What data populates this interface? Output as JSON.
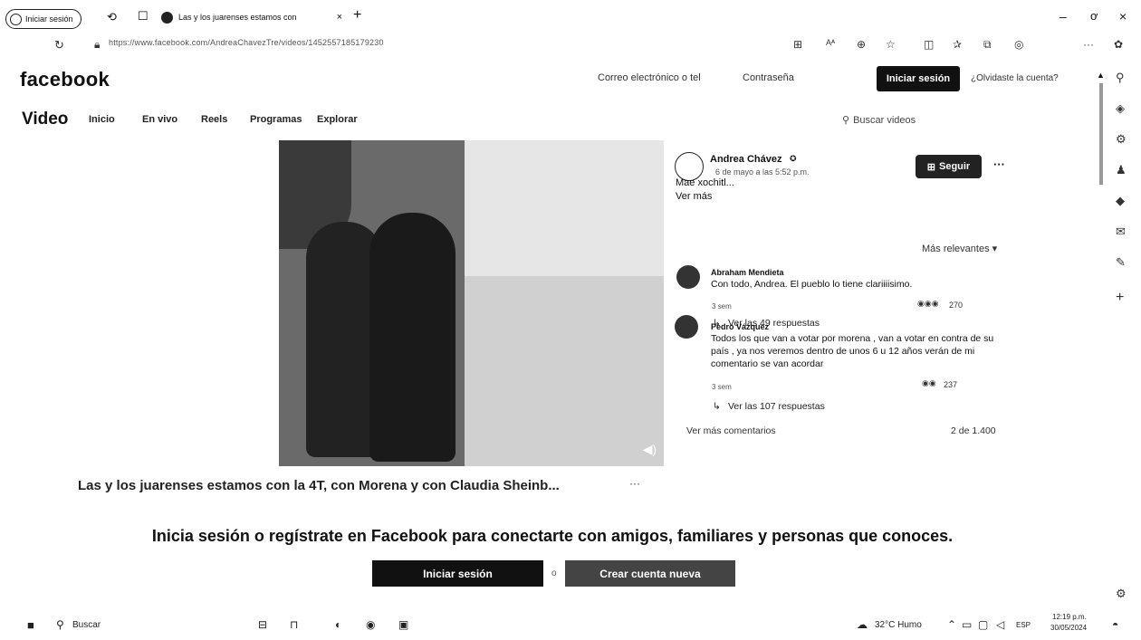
{
  "browser": {
    "signin_pill": "Iniciar sesión",
    "tab_title": "Las y los juarenses estamos con",
    "new_tab": "+",
    "url": "https://www.facebook.com/AndreaChavezTre/videos/1452557185179230",
    "minimize": "–",
    "maximize": "ơ",
    "close": "×"
  },
  "header": {
    "logo": "facebook",
    "email_placeholder": "Correo electrónico o tel",
    "password_placeholder": "Contraseña",
    "login_label": "Iniciar sesión",
    "forgot_label": "¿Olvidaste la cuenta?"
  },
  "video_nav": {
    "title": "Video",
    "items": [
      "Inicio",
      "En vivo",
      "Reels",
      "Programas",
      "Explorar"
    ],
    "search_placeholder": "Buscar videos"
  },
  "post": {
    "author": "Andrea Chávez",
    "time": "6 de mayo a las 5:52 p.m.",
    "text": "Mae xochitl...",
    "see_more": "Ver más",
    "follow_label": "Seguir",
    "menu": "···",
    "caption": "Las y los juarenses estamos con la 4T, con Morena y con Claudia Sheinb...",
    "caption_menu": "···"
  },
  "comments": {
    "sort": "Más relevantes ▾",
    "items": [
      {
        "name": "Abraham Mendieta",
        "text": "Con todo, Andrea. El pueblo lo tiene clariiiisimo.",
        "time": "3 sem",
        "reactions": "270",
        "replies": "Ver las 49 respuestas"
      },
      {
        "name": "Pedro Vázquez",
        "text": "Todos los que van a votar por morena , van a votar en contra de su país , ya nos veremos dentro de unos 6 u 12 años verán de mi comentario se van acordar",
        "time": "3 sem",
        "reactions": "237",
        "replies": "Ver las 107 respuestas"
      }
    ],
    "more_comments": "Ver más comentarios",
    "count": "2 de 1.400"
  },
  "prompt": {
    "text": "Inicia sesión o regístrate en Facebook para conectarte con amigos, familiares y personas que conoces.",
    "login_label": "Iniciar sesión",
    "separator": "o",
    "create_label": "Crear cuenta nueva"
  },
  "taskbar": {
    "search": "Buscar",
    "weather": "32°C Humo",
    "lang": "ESP",
    "time": "12:19 p.m.",
    "date": "30/05/2024"
  }
}
